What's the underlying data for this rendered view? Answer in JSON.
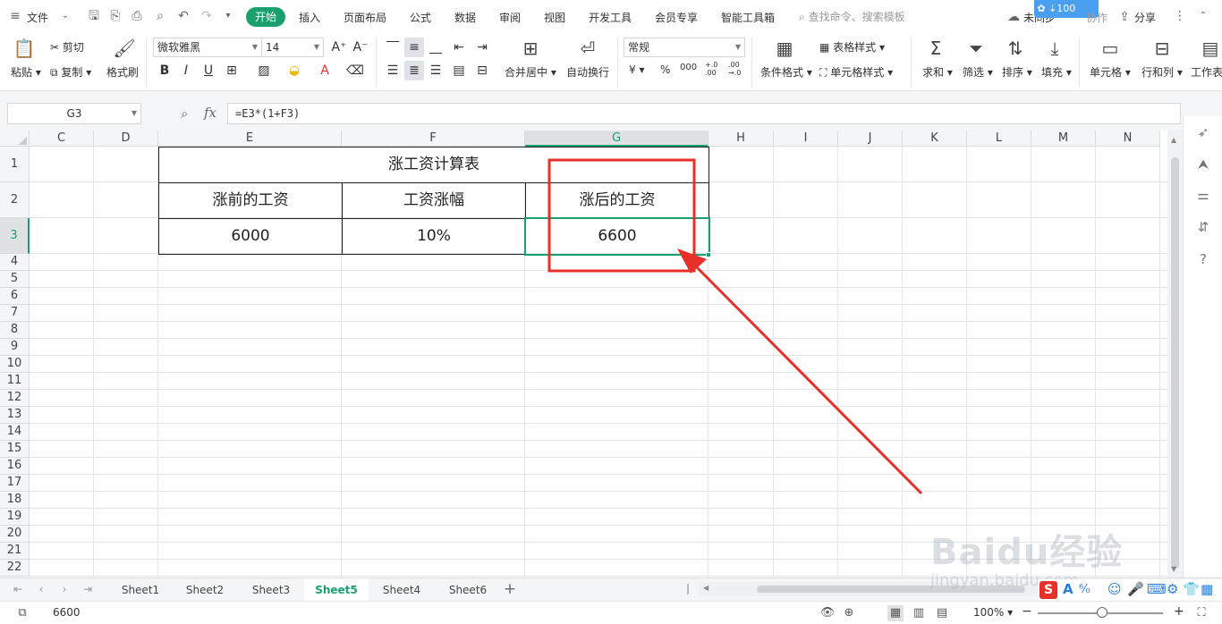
{
  "menubar": {
    "file_label": "文件",
    "tabs": [
      "开始",
      "插入",
      "页面布局",
      "公式",
      "数据",
      "审阅",
      "视图",
      "开发工具",
      "会员专享",
      "智能工具箱"
    ],
    "search_placeholder": "查找命令、搜索模板",
    "speed_badge": "100 KB/s",
    "sync_label": "未同步",
    "collab_label": "协作",
    "share_label": "分享"
  },
  "ribbon": {
    "paste": "粘贴",
    "cut": "剪切",
    "copy": "复制",
    "format_painter": "格式刷",
    "font_name": "微软雅黑",
    "font_size": "14",
    "merge_center": "合并居中",
    "wrap_text": "自动换行",
    "number_format": "常规",
    "currency": "¥",
    "percent": "%",
    "thousands": "000",
    "inc_decimal": "+.0\n.00",
    "dec_decimal": ".00\n→.0",
    "conditional_format": "条件格式",
    "table_style": "表格样式",
    "cell_style": "单元格样式",
    "sum": "求和",
    "filter": "筛选",
    "sort": "排序",
    "fill": "填充",
    "cell": "单元格",
    "row_col": "行和列",
    "worksheet": "工作表"
  },
  "formula_bar": {
    "name_box": "G3",
    "fx_label": "fx",
    "formula": "=E3*(1+F3)"
  },
  "grid": {
    "columns": [
      "C",
      "D",
      "E",
      "F",
      "G",
      "H",
      "I",
      "J",
      "K",
      "L",
      "M",
      "N"
    ],
    "rows": [
      "1",
      "2",
      "3",
      "4",
      "5",
      "6",
      "7",
      "8",
      "9",
      "10",
      "11",
      "12",
      "13",
      "14",
      "15",
      "16",
      "17",
      "18",
      "19",
      "20",
      "21",
      "22"
    ],
    "active_column": "G",
    "active_row": "3",
    "table": {
      "title": "涨工资计算表",
      "headers": [
        "涨前的工资",
        "工资涨幅",
        "涨后的工资"
      ],
      "values": [
        "6000",
        "10%",
        "6600"
      ]
    }
  },
  "sheets": {
    "tabs": [
      "Sheet1",
      "Sheet2",
      "Sheet3",
      "Sheet5",
      "Sheet4",
      "Sheet6"
    ],
    "active": "Sheet5",
    "add_label": "+"
  },
  "statusbar": {
    "value": "6600",
    "zoom": "100%"
  },
  "watermark": {
    "brand": "Baidu经验",
    "url": "jingyan.baidu.com"
  },
  "colors": {
    "accent": "#1aa06d",
    "annotation": "#e8302a"
  },
  "icons": {
    "menu": "hamburger-icon",
    "save": "save-icon",
    "undo": "undo-icon",
    "redo": "redo-icon",
    "print": "print-icon",
    "search": "magnifier-icon",
    "cloud": "cloud-icon",
    "share": "share-icon"
  }
}
